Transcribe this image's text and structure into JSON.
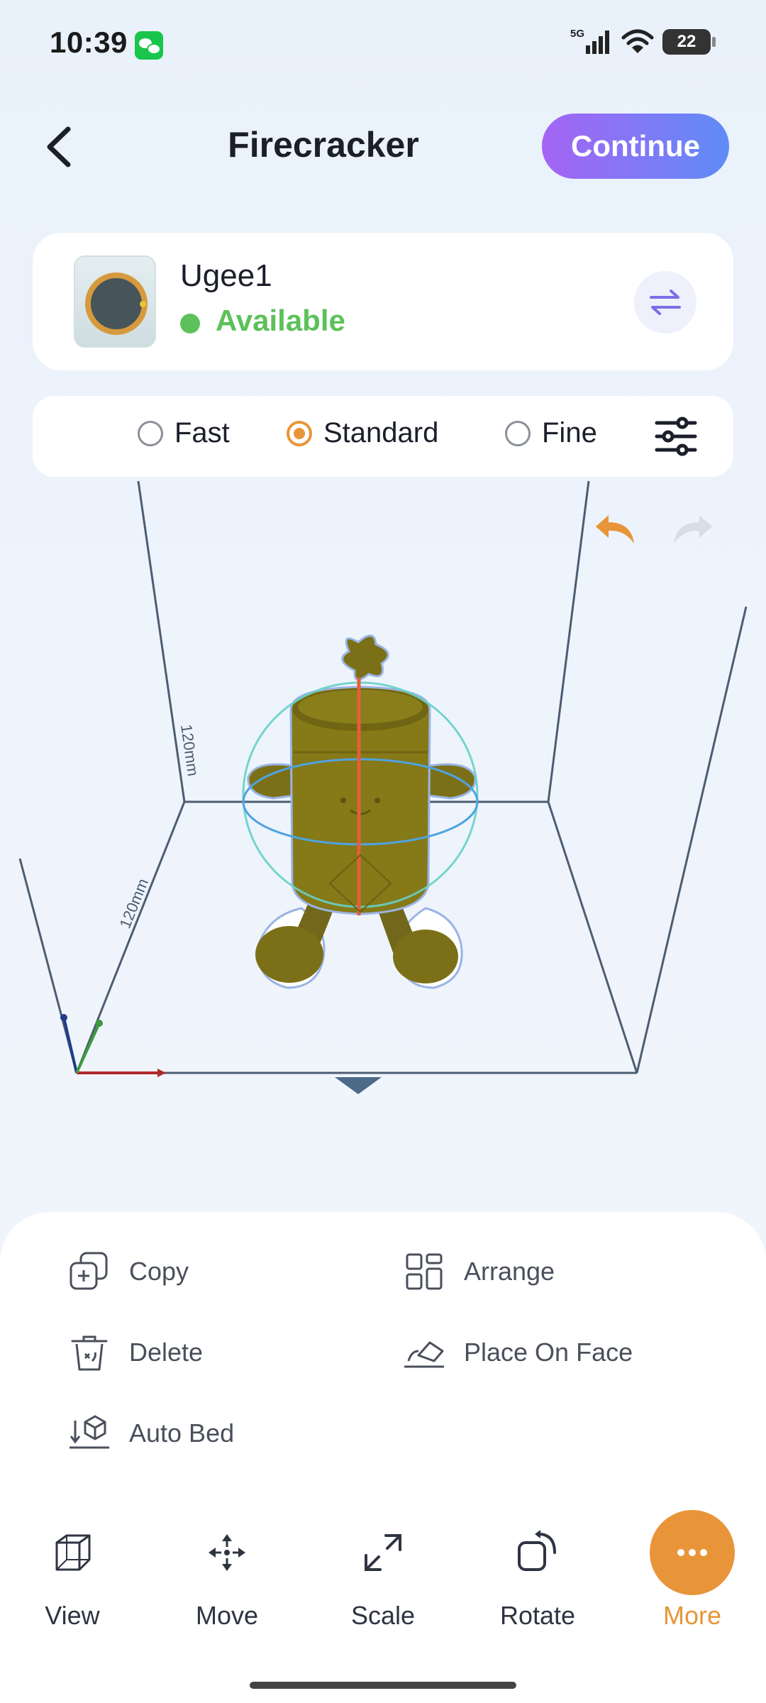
{
  "status_bar": {
    "time": "10:39",
    "network": "5G",
    "battery": "22",
    "icons": [
      "wechat-icon",
      "signal-icon",
      "wifi-icon",
      "battery-icon"
    ]
  },
  "header": {
    "title": "Firecracker",
    "continue_label": "Continue",
    "back_icon": "chevron-left-icon"
  },
  "printer": {
    "name": "Ugee1",
    "status": "Available",
    "status_color": "#5cc15a",
    "swap_icon": "swap-arrows-icon"
  },
  "quality": {
    "options": [
      "Fast",
      "Standard",
      "Fine"
    ],
    "selected": "Standard",
    "settings_icon": "sliders-icon"
  },
  "viewport": {
    "height_label": "120mm",
    "depth_label": "120mm",
    "undo_icon": "undo-icon",
    "redo_icon": "redo-icon",
    "model_color": "#807416"
  },
  "actions": {
    "copy": "Copy",
    "arrange": "Arrange",
    "delete": "Delete",
    "place_on_face": "Place On Face",
    "auto_bed": "Auto Bed"
  },
  "tabs": [
    {
      "label": "View",
      "icon": "cube-icon"
    },
    {
      "label": "Move",
      "icon": "move-arrows-icon"
    },
    {
      "label": "Scale",
      "icon": "scale-arrows-icon"
    },
    {
      "label": "Rotate",
      "icon": "rotate-icon"
    },
    {
      "label": "More",
      "icon": "more-dots-icon",
      "active": true
    }
  ],
  "colors": {
    "accent_orange": "#e8953a",
    "button_gradient_start": "#a564f5",
    "button_gradient_end": "#5f8cf6"
  }
}
